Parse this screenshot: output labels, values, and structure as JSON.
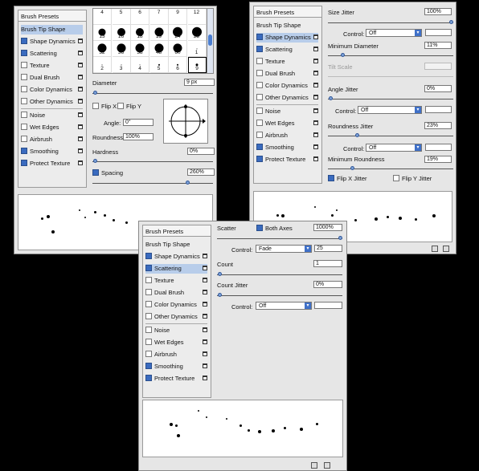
{
  "panels": {
    "left_list": {
      "header": "Brush Presets",
      "tip_shape": "Brush Tip Shape",
      "items": [
        {
          "label": "Shape Dynamics",
          "checked": true
        },
        {
          "label": "Scattering",
          "checked": true
        },
        {
          "label": "Texture",
          "checked": false
        },
        {
          "label": "Dual Brush",
          "checked": false
        },
        {
          "label": "Color Dynamics",
          "checked": false
        },
        {
          "label": "Other Dynamics",
          "checked": false
        },
        {
          "label": "Noise",
          "checked": false
        },
        {
          "label": "Wet Edges",
          "checked": false
        },
        {
          "label": "Airbrush",
          "checked": false
        },
        {
          "label": "Smoothing",
          "checked": true
        },
        {
          "label": "Protect Texture",
          "checked": true
        }
      ]
    },
    "tip_shape": {
      "brush_grid": [
        {
          "top": "4"
        },
        {
          "top": "5"
        },
        {
          "top": "6"
        },
        {
          "top": "7"
        },
        {
          "top": "9"
        },
        {
          "top": "12"
        },
        {
          "num": "13"
        },
        {
          "num": "16"
        },
        {
          "num": "18"
        },
        {
          "num": "19"
        },
        {
          "num": "24"
        },
        {
          "num": "28"
        },
        {
          "num": "32"
        },
        {
          "num": "36"
        },
        {
          "num": "38"
        },
        {
          "num": "48"
        },
        {
          "num": "60"
        },
        {
          "num": "1"
        },
        {
          "num": "2"
        },
        {
          "num": "3"
        },
        {
          "num": "4"
        },
        {
          "num": "5"
        },
        {
          "num": "6"
        },
        {
          "num": "9"
        }
      ],
      "diameter_label": "Diameter",
      "diameter_value": "9 px",
      "flip_x": "Flip X",
      "flip_y": "Flip Y",
      "angle_label": "Angle:",
      "angle_value": "0°",
      "roundness_label": "Roundness:",
      "roundness_value": "100%",
      "hardness_label": "Hardness",
      "hardness_value": "0%",
      "spacing_label": "Spacing",
      "spacing_value": "260%",
      "spacing_checked": true
    },
    "shape_dynamics": {
      "size_jitter_label": "Size Jitter",
      "size_jitter_value": "100%",
      "control_label": "Control:",
      "control_off": "Off",
      "min_diameter_label": "Minimum Diameter",
      "min_diameter_value": "11%",
      "tilt_scale_label": "Tilt Scale",
      "angle_jitter_label": "Angle Jitter",
      "angle_jitter_value": "0%",
      "roundness_jitter_label": "Roundness Jitter",
      "roundness_jitter_value": "23%",
      "min_roundness_label": "Minimum Roundness",
      "min_roundness_value": "19%",
      "flip_x_jitter": "Flip X Jitter",
      "flip_y_jitter": "Flip Y Jitter"
    },
    "scattering": {
      "scatter_label": "Scatter",
      "both_axes": "Both Axes",
      "scatter_value": "1000%",
      "control_label": "Control:",
      "control_fade": "Fade",
      "fade_value": "25",
      "count_label": "Count",
      "count_value": "1",
      "count_jitter_label": "Count Jitter",
      "count_jitter_value": "0%",
      "control_off": "Off"
    }
  },
  "accent": "#3a6bbf"
}
